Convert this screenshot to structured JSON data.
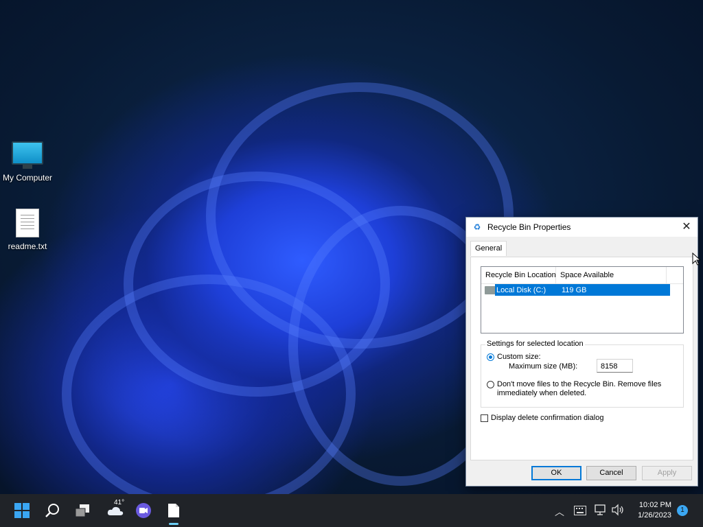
{
  "desktop": {
    "icons": [
      {
        "label": "My Computer",
        "icon": "monitor-icon"
      },
      {
        "label": "readme.txt",
        "icon": "text-file-icon"
      }
    ]
  },
  "dialog": {
    "title": "Recycle Bin Properties",
    "title_icon": "recycle-bin-icon",
    "close_glyph": "✕",
    "tab": "General",
    "list": {
      "headers": [
        "Recycle Bin Location",
        "Space Available"
      ],
      "rows": [
        {
          "location": "Local Disk (C:)",
          "space": "119 GB",
          "selected": true
        }
      ]
    },
    "group_label": "Settings for selected location",
    "custom_size_label": "Custom size:",
    "custom_size_checked": true,
    "max_size_label": "Maximum size (MB):",
    "max_size_value": "8158",
    "dont_move_label_line1": "Don't move files to the Recycle Bin. Remove files",
    "dont_move_label_line2": "immediately when deleted.",
    "dont_move_checked": false,
    "confirm_label": "Display delete confirmation dialog",
    "confirm_checked": false,
    "buttons": {
      "ok": "OK",
      "cancel": "Cancel",
      "apply": "Apply"
    },
    "apply_enabled": false
  },
  "taskbar": {
    "weather_temp": "41°",
    "clock_time": "10:02 PM",
    "clock_date": "1/26/2023",
    "notification_count": "1",
    "accent": "#3aa6f3",
    "background": "#202328"
  }
}
